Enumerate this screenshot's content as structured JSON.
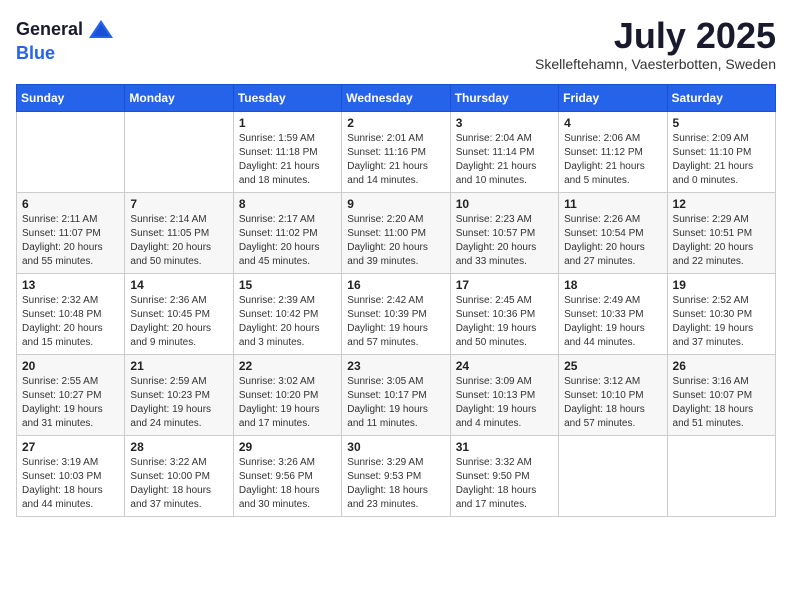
{
  "logo": {
    "general": "General",
    "blue": "Blue"
  },
  "title": "July 2025",
  "subtitle": "Skelleftehamn, Vaesterbotten, Sweden",
  "days_of_week": [
    "Sunday",
    "Monday",
    "Tuesday",
    "Wednesday",
    "Thursday",
    "Friday",
    "Saturday"
  ],
  "weeks": [
    [
      {
        "day": "",
        "content": ""
      },
      {
        "day": "",
        "content": ""
      },
      {
        "day": "1",
        "content": "Sunrise: 1:59 AM\nSunset: 11:18 PM\nDaylight: 21 hours and 18 minutes."
      },
      {
        "day": "2",
        "content": "Sunrise: 2:01 AM\nSunset: 11:16 PM\nDaylight: 21 hours and 14 minutes."
      },
      {
        "day": "3",
        "content": "Sunrise: 2:04 AM\nSunset: 11:14 PM\nDaylight: 21 hours and 10 minutes."
      },
      {
        "day": "4",
        "content": "Sunrise: 2:06 AM\nSunset: 11:12 PM\nDaylight: 21 hours and 5 minutes."
      },
      {
        "day": "5",
        "content": "Sunrise: 2:09 AM\nSunset: 11:10 PM\nDaylight: 21 hours and 0 minutes."
      }
    ],
    [
      {
        "day": "6",
        "content": "Sunrise: 2:11 AM\nSunset: 11:07 PM\nDaylight: 20 hours and 55 minutes."
      },
      {
        "day": "7",
        "content": "Sunrise: 2:14 AM\nSunset: 11:05 PM\nDaylight: 20 hours and 50 minutes."
      },
      {
        "day": "8",
        "content": "Sunrise: 2:17 AM\nSunset: 11:02 PM\nDaylight: 20 hours and 45 minutes."
      },
      {
        "day": "9",
        "content": "Sunrise: 2:20 AM\nSunset: 11:00 PM\nDaylight: 20 hours and 39 minutes."
      },
      {
        "day": "10",
        "content": "Sunrise: 2:23 AM\nSunset: 10:57 PM\nDaylight: 20 hours and 33 minutes."
      },
      {
        "day": "11",
        "content": "Sunrise: 2:26 AM\nSunset: 10:54 PM\nDaylight: 20 hours and 27 minutes."
      },
      {
        "day": "12",
        "content": "Sunrise: 2:29 AM\nSunset: 10:51 PM\nDaylight: 20 hours and 22 minutes."
      }
    ],
    [
      {
        "day": "13",
        "content": "Sunrise: 2:32 AM\nSunset: 10:48 PM\nDaylight: 20 hours and 15 minutes."
      },
      {
        "day": "14",
        "content": "Sunrise: 2:36 AM\nSunset: 10:45 PM\nDaylight: 20 hours and 9 minutes."
      },
      {
        "day": "15",
        "content": "Sunrise: 2:39 AM\nSunset: 10:42 PM\nDaylight: 20 hours and 3 minutes."
      },
      {
        "day": "16",
        "content": "Sunrise: 2:42 AM\nSunset: 10:39 PM\nDaylight: 19 hours and 57 minutes."
      },
      {
        "day": "17",
        "content": "Sunrise: 2:45 AM\nSunset: 10:36 PM\nDaylight: 19 hours and 50 minutes."
      },
      {
        "day": "18",
        "content": "Sunrise: 2:49 AM\nSunset: 10:33 PM\nDaylight: 19 hours and 44 minutes."
      },
      {
        "day": "19",
        "content": "Sunrise: 2:52 AM\nSunset: 10:30 PM\nDaylight: 19 hours and 37 minutes."
      }
    ],
    [
      {
        "day": "20",
        "content": "Sunrise: 2:55 AM\nSunset: 10:27 PM\nDaylight: 19 hours and 31 minutes."
      },
      {
        "day": "21",
        "content": "Sunrise: 2:59 AM\nSunset: 10:23 PM\nDaylight: 19 hours and 24 minutes."
      },
      {
        "day": "22",
        "content": "Sunrise: 3:02 AM\nSunset: 10:20 PM\nDaylight: 19 hours and 17 minutes."
      },
      {
        "day": "23",
        "content": "Sunrise: 3:05 AM\nSunset: 10:17 PM\nDaylight: 19 hours and 11 minutes."
      },
      {
        "day": "24",
        "content": "Sunrise: 3:09 AM\nSunset: 10:13 PM\nDaylight: 19 hours and 4 minutes."
      },
      {
        "day": "25",
        "content": "Sunrise: 3:12 AM\nSunset: 10:10 PM\nDaylight: 18 hours and 57 minutes."
      },
      {
        "day": "26",
        "content": "Sunrise: 3:16 AM\nSunset: 10:07 PM\nDaylight: 18 hours and 51 minutes."
      }
    ],
    [
      {
        "day": "27",
        "content": "Sunrise: 3:19 AM\nSunset: 10:03 PM\nDaylight: 18 hours and 44 minutes."
      },
      {
        "day": "28",
        "content": "Sunrise: 3:22 AM\nSunset: 10:00 PM\nDaylight: 18 hours and 37 minutes."
      },
      {
        "day": "29",
        "content": "Sunrise: 3:26 AM\nSunset: 9:56 PM\nDaylight: 18 hours and 30 minutes."
      },
      {
        "day": "30",
        "content": "Sunrise: 3:29 AM\nSunset: 9:53 PM\nDaylight: 18 hours and 23 minutes."
      },
      {
        "day": "31",
        "content": "Sunrise: 3:32 AM\nSunset: 9:50 PM\nDaylight: 18 hours and 17 minutes."
      },
      {
        "day": "",
        "content": ""
      },
      {
        "day": "",
        "content": ""
      }
    ]
  ]
}
